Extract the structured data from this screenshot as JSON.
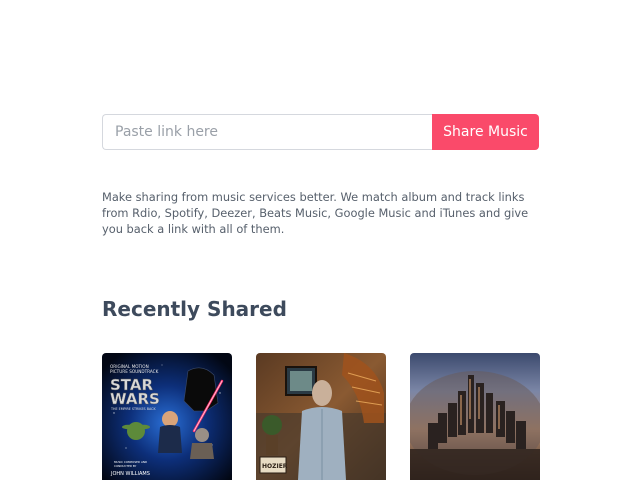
{
  "share": {
    "placeholder": "Paste link here",
    "button_label": "Share Music",
    "accent_color": "#fa4a6a"
  },
  "description": "Make sharing from music services better. We match album and track links from Rdio, Spotify, Deezer, Beats Music, Google Music and iTunes and give you back a link with all of them.",
  "recent": {
    "title": "Recently Shared",
    "albums": [
      {
        "cover_top_text_1": "ORIGINAL MOTION",
        "cover_top_text_2": "PICTURE SOUNDTRACK",
        "cover_title": "STAR",
        "cover_title_2": "WARS",
        "cover_subtitle": "THE EMPIRE STRIKES BACK",
        "cover_credit_1": "MUSIC COMPOSED AND",
        "cover_credit_2": "CONDUCTED BY",
        "cover_artist": "JOHN WILLIAMS"
      },
      {
        "cover_text": "HOZIER"
      },
      {}
    ]
  }
}
